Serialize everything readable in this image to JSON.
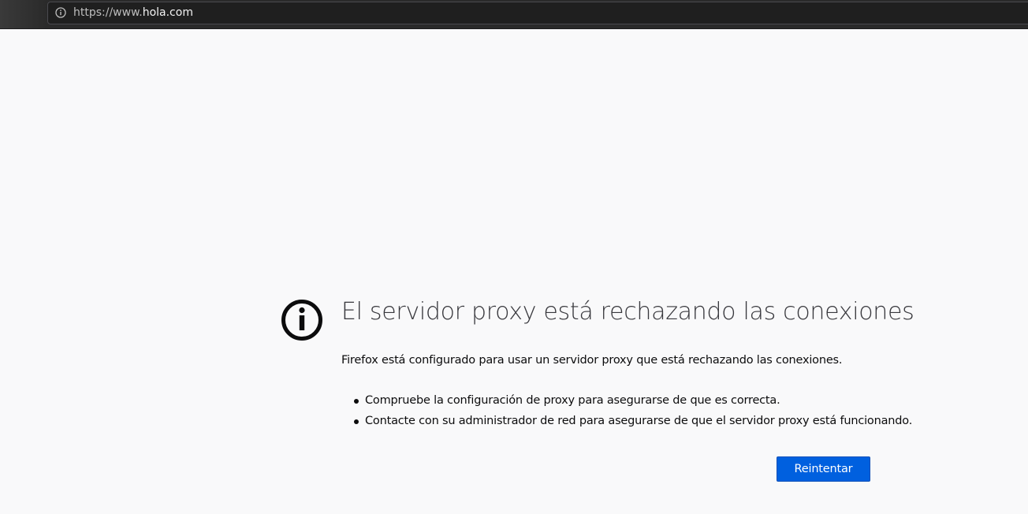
{
  "browser": {
    "url_scheme_prefix": "https://www.",
    "url_host": "hola.com",
    "url_icon": "info-icon"
  },
  "error_page": {
    "icon": "info-circle-icon",
    "title": "El servidor proxy está rechazando las conexiones",
    "description": "Firefox está configurado para usar un servidor proxy que está rechazando las conexiones.",
    "tips": [
      "Compruebe la configuración de proxy para asegurarse de que es correcta.",
      "Contacte con su administrador de red para asegurarse de que el servidor proxy está funcionando."
    ],
    "retry_label": "Reintentar",
    "accent_color": "#0060df"
  }
}
